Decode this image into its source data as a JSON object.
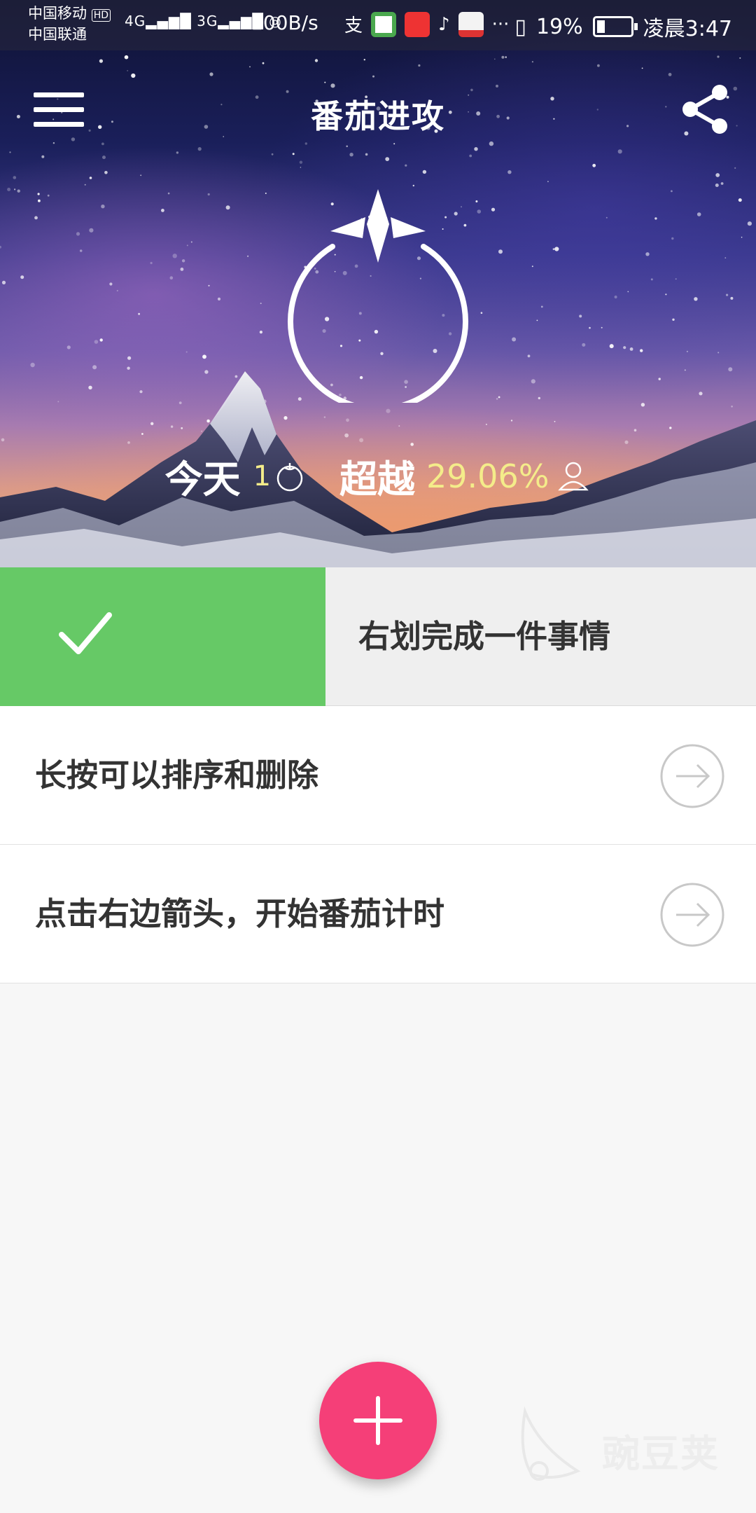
{
  "status_bar": {
    "carrier_1": "中国移动",
    "hd_badge": "HD",
    "carrier_2": "中国联通",
    "signal_1": "4G",
    "signal_2": "3G",
    "net_speed": "100B/s",
    "battery_percent": "19%",
    "time": "凌晨3:47",
    "app_icons": [
      "alipay-icon",
      "news-icon",
      "toutiao-icon",
      "tiktok-icon",
      "video-icon"
    ],
    "more_dots": "···"
  },
  "toolbar": {
    "title": "番茄进攻",
    "menu_icon": "hamburger-menu-icon",
    "share_icon": "share-icon"
  },
  "hero": {
    "today_label": "今天",
    "today_count": "1",
    "surpass_label": "超越",
    "surpass_percent": "29.06%"
  },
  "tasks": [
    {
      "text": "右划完成一件事情",
      "state": "swiped-complete"
    },
    {
      "text": "长按可以排序和删除",
      "action_icon": "arrow-right-circle-icon"
    },
    {
      "text": "点击右边箭头，开始番茄计时",
      "action_icon": "arrow-right-circle-icon"
    }
  ],
  "fab": {
    "icon": "plus-icon"
  },
  "watermark": {
    "text": "豌豆荚"
  },
  "colors": {
    "swipe_green": "#66c966",
    "fab_pink": "#f53f78",
    "stat_yellow": "#f4ec8a"
  }
}
